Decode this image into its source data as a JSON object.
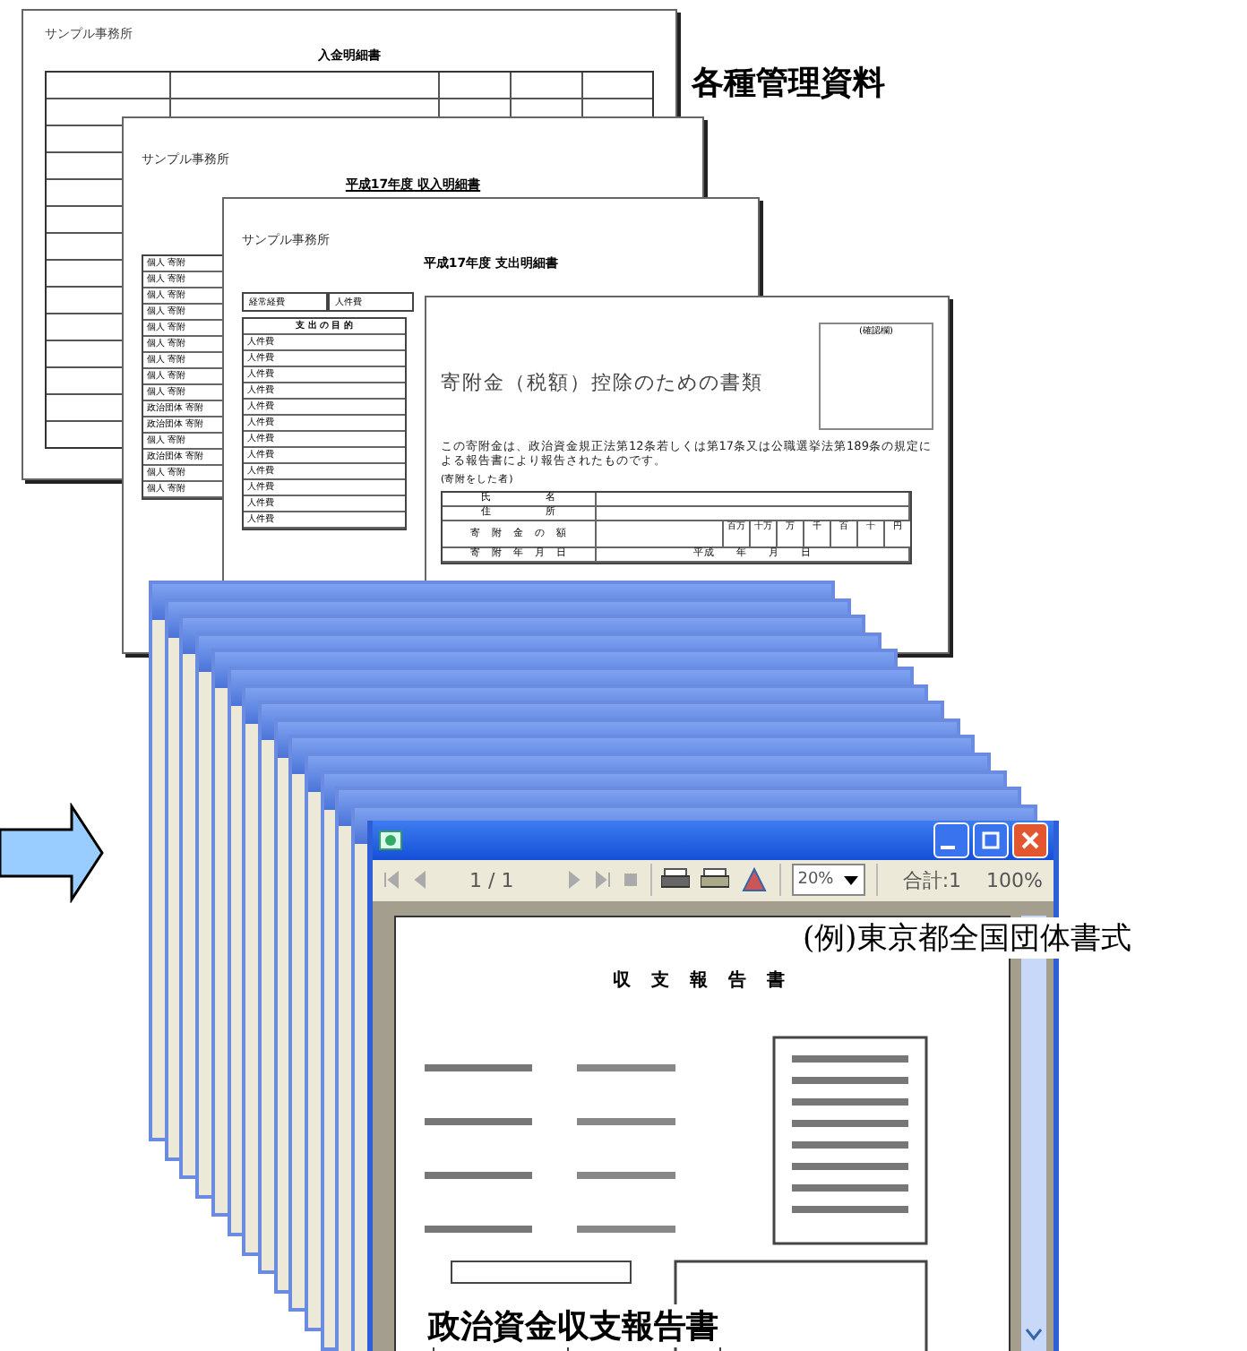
{
  "captions": [
    {
      "text": "各種管理資料",
      "kind": "top"
    },
    {
      "text": "(例)東京都全国団体書式",
      "kind": "middle"
    },
    {
      "text": "政治資金収支報告書",
      "kind": "bottom"
    }
  ],
  "ledger": {
    "office": "サンプル事務所",
    "title": "入金明細書"
  },
  "income": {
    "office": "サンプル事務所",
    "title": "平成17年度 収入明細書",
    "rows": [
      "個人 寄附",
      "個人 寄附",
      "個人 寄附",
      "個人 寄附",
      "個人 寄附",
      "個人 寄附",
      "個人 寄附",
      "個人 寄附",
      "個人 寄附",
      "政治団体 寄附",
      "政治団体 寄附",
      "個人 寄附",
      "政治団体 寄附",
      "個人 寄附",
      "個人 寄附"
    ]
  },
  "expense": {
    "office": "サンプル事務所",
    "title": "平成17年度 支出明細書",
    "category": "経常経費",
    "subcategory": "人件費",
    "header": "支 出 の 目 的",
    "rows": [
      "人件費",
      "人件費",
      "人件費",
      "人件費",
      "人件費",
      "人件費",
      "人件費",
      "人件費",
      "人件費",
      "人件費",
      "人件費",
      "人件費"
    ]
  },
  "donation": {
    "check_label": "(確認欄)",
    "title": "寄附金（税額）控除のための書類",
    "note": "この寄附金は、政治資金規正法第12条若しくは第17条又は公職選挙法第189条の規定による報告書により報告されたものです。",
    "donor_label": "(寄附をした者)",
    "name_label": "氏　　　　　名",
    "address_label": "住　　　　　所",
    "amount_label": "寄　附　金　の　額",
    "digits": [
      "百万",
      "十万",
      "万",
      "千",
      "百",
      "十",
      "円"
    ],
    "date_label": "寄　附　年　月　日",
    "date_value": "平成　　年　　月　　日"
  },
  "viewer": {
    "page": "1 / 1",
    "zoom": "20%",
    "total": "合計:1",
    "percent": "100%",
    "report_title": "収 支 報 告 書"
  }
}
